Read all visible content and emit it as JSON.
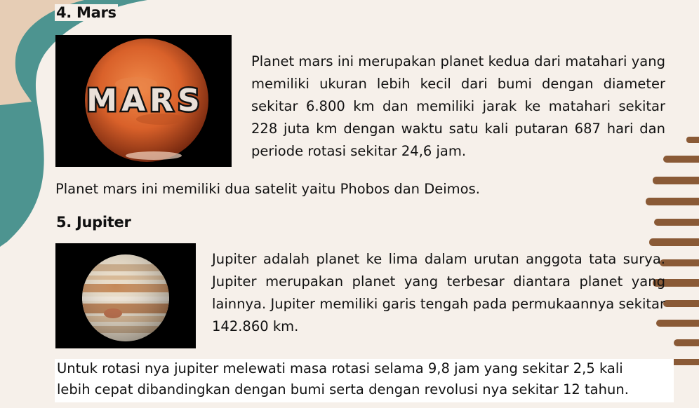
{
  "mars": {
    "heading": "4. Mars",
    "image_label": "MARS",
    "description": "Planet mars ini merupakan planet kedua dari matahari yang memiliki ukuran lebih kecil dari bumi dengan diameter sekitar 6.800 km dan memiliki jarak ke matahari sekitar 228 juta km dengan waktu satu kali putaran 687 hari dan periode rotasi sekitar 24,6 jam.",
    "satellites": "Planet mars ini memiliki dua satelit yaitu Phobos dan Deimos."
  },
  "jupiter": {
    "heading": "5. Jupiter",
    "description": "Jupiter adalah planet ke lima dalam urutan anggota tata surya. Jupiter merupakan planet yang terbesar diantara planet yang lainnya. Jupiter memiliki garis tengah pada permukaannya sekitar 142.860 km.",
    "rotation_line1": "Untuk rotasi nya jupiter melewati masa rotasi selama 9,8 jam yang sekitar 2,5 kali",
    "rotation_line2": "lebih cepat dibandingkan dengan bumi serta dengan revolusi nya sekitar 12 tahun."
  },
  "colors": {
    "background": "#f6f0ea",
    "teal_shape": "#4a8f8a",
    "brown_strokes": "#8a5a36"
  }
}
